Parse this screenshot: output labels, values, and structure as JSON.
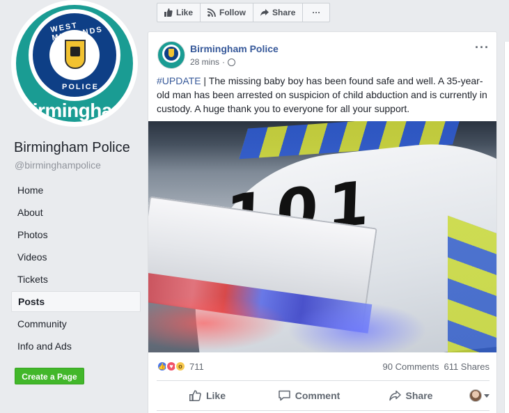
{
  "sidebar": {
    "avatar": {
      "ring_top_text": "WEST MIDLANDS",
      "ring_bottom_text": "POLICE",
      "city_text": "Birmingham"
    },
    "page_name": "Birmingham Police",
    "page_handle": "@birminghampolice",
    "nav": [
      {
        "label": "Home",
        "active": false
      },
      {
        "label": "About",
        "active": false
      },
      {
        "label": "Photos",
        "active": false
      },
      {
        "label": "Videos",
        "active": false
      },
      {
        "label": "Tickets",
        "active": false
      },
      {
        "label": "Posts",
        "active": true
      },
      {
        "label": "Community",
        "active": false
      },
      {
        "label": "Info and Ads",
        "active": false
      }
    ],
    "create_page_label": "Create a Page"
  },
  "action_bar": {
    "like_label": "Like",
    "follow_label": "Follow",
    "share_label": "Share",
    "more_label": "···"
  },
  "post": {
    "author": "Birmingham Police",
    "time": "28 mins",
    "meta_separator": "·",
    "more_label": "···",
    "hashtag": "#UPDATE",
    "text": " | The missing baby boy has been found safe and well. A 35-year-old man has been arrested on suspicion of child abduction and is currently in custody. A huge thank you to everyone for all your support.",
    "image_text": "101",
    "reaction_count": "711",
    "comments": "90 Comments",
    "shares": "611 Shares",
    "actions": {
      "like": "Like",
      "comment": "Comment",
      "share": "Share"
    }
  },
  "colors": {
    "link_blue": "#365899",
    "create_green": "#42b72a",
    "avatar_teal": "#1a9c93",
    "badge_navy": "#0e3f86"
  }
}
